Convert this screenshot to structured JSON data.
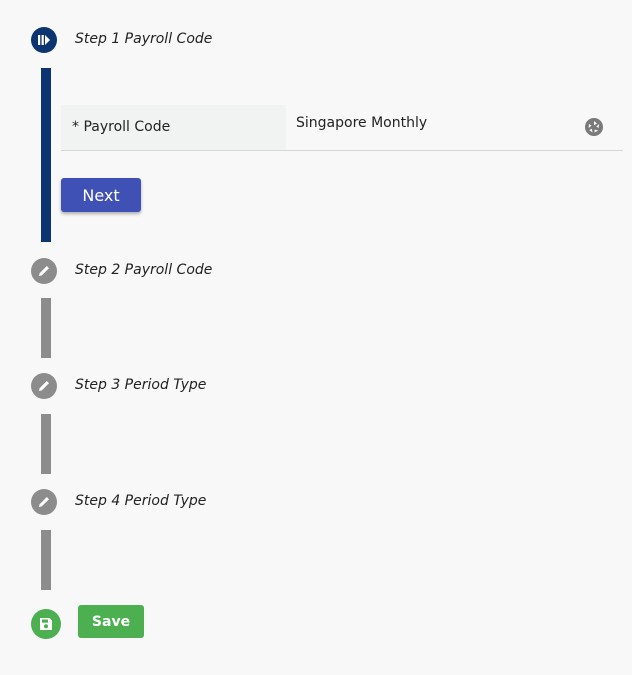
{
  "steps": [
    {
      "label": "Step 1 Payroll Code",
      "state": "active",
      "icon": "stepper-icon"
    },
    {
      "label": "Step 2 Payroll Code",
      "state": "pending",
      "icon": "pencil-icon"
    },
    {
      "label": "Step 3 Period Type",
      "state": "pending",
      "icon": "pencil-icon"
    },
    {
      "label": "Step 4 Period Type",
      "state": "pending",
      "icon": "pencil-icon"
    }
  ],
  "form": {
    "payroll_code_label": "* Payroll Code",
    "payroll_code_value": "Singapore Monthly",
    "lookup_icon": "aperture-icon"
  },
  "buttons": {
    "next_label": "Next",
    "save_label": "Save",
    "save_icon": "floppy-disk-icon"
  },
  "colors": {
    "active_step": "#0b3470",
    "pending_step": "#8c8c8c",
    "next_button": "#3f51b5",
    "save_button": "#4caf50"
  }
}
